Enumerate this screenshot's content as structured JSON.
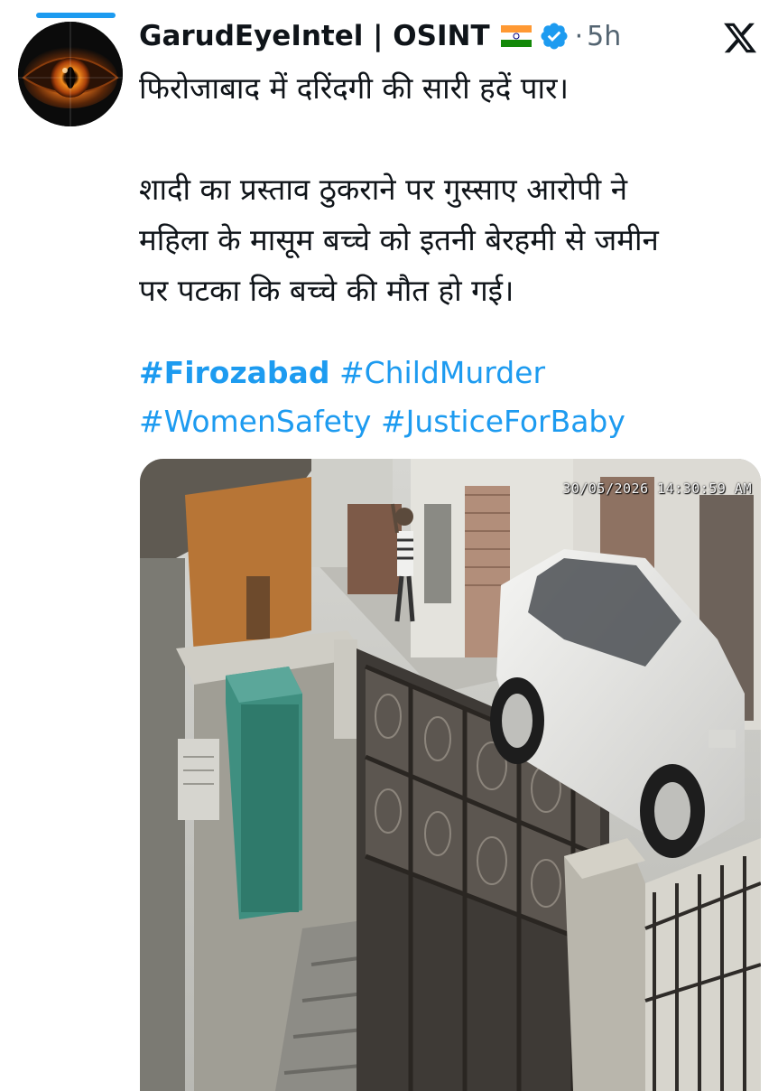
{
  "tweet": {
    "author": {
      "display_name": "GarudEyeIntel | OSINT",
      "flag_icon": "india-flag-icon",
      "verified_icon": "verified-badge-icon",
      "verified_color": "#1d9bf0"
    },
    "time_separator": "·",
    "timestamp": "5h",
    "platform_icon": "x-logo-icon",
    "text_lines": [
      "फिरोजाबाद में दरिंदगी की सारी हदें पार।",
      "शादी का प्रस्ताव ठुकराने पर गुस्साए आरोपी ने",
      "महिला के मासूम बच्चे को इतनी बेरहमी से जमीन",
      "पर पटका कि बच्चे की मौत हो गई।"
    ],
    "hashtags": [
      "#Firozabad",
      "#ChildMurder",
      "#WomenSafety",
      "#JusticeForBaby"
    ],
    "hashtag_color": "#1d9bf0",
    "media": {
      "type": "cctv-video-still",
      "overlay_timestamp": "30/05/2026 14:30:59 AM"
    }
  }
}
